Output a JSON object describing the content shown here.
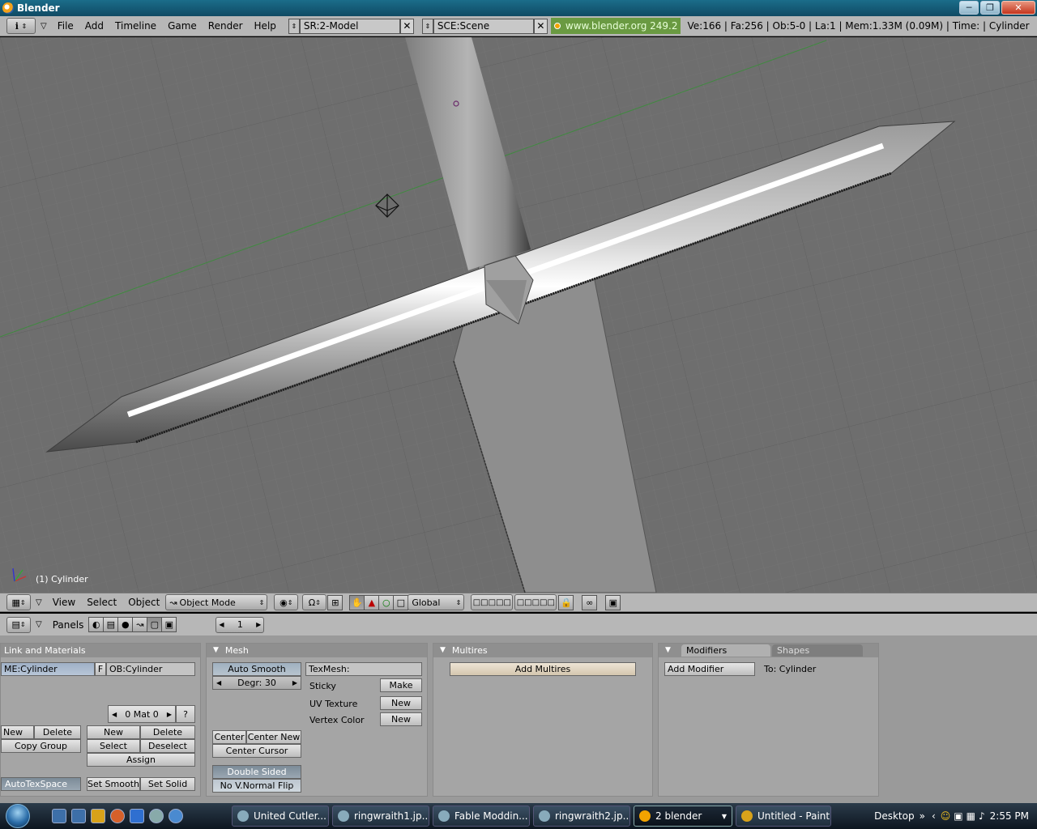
{
  "window": {
    "title": "Blender"
  },
  "infobar": {
    "menus": [
      "File",
      "Add",
      "Timeline",
      "Game",
      "Render",
      "Help"
    ],
    "screen": "SR:2-Model",
    "scene": "SCE:Scene",
    "url": "www.blender.org 249.2",
    "stats": "Ve:166 | Fa:256 | Ob:5-0 | La:1  | Mem:1.33M (0.09M)  | Time: | Cylinder"
  },
  "viewport": {
    "object_label": "(1) Cylinder"
  },
  "view_header": {
    "menus": [
      "View",
      "Select",
      "Object"
    ],
    "mode": "Object Mode",
    "orientation": "Global"
  },
  "buttons_header": {
    "panels_label": "Panels",
    "frame": "1"
  },
  "link_panel": {
    "title": "Link and Materials",
    "mesh_name": "ME:Cylinder",
    "f_label": "F",
    "object_name": "OB:Cylinder",
    "mat_field": "0 Mat 0",
    "question": "?",
    "new": "New",
    "delete": "Delete",
    "copy_group": "Copy Group",
    "mat_new": "New",
    "mat_delete": "Delete",
    "mat_select": "Select",
    "mat_deselect": "Deselect",
    "assign": "Assign",
    "autotexspace": "AutoTexSpace",
    "set_smooth": "Set Smooth",
    "set_solid": "Set Solid"
  },
  "mesh_panel": {
    "title": "Mesh",
    "auto_smooth": "Auto Smooth",
    "degr": "Degr: 30",
    "texmesh": "TexMesh:",
    "sticky": "Sticky",
    "sticky_btn": "Make",
    "uv_texture": "UV Texture",
    "uv_btn": "New",
    "vertex_color": "Vertex Color",
    "vc_btn": "New",
    "center": "Center",
    "center_new": "Center New",
    "center_cursor": "Center Cursor",
    "double_sided": "Double Sided",
    "no_vnormal_flip": "No V.Normal Flip"
  },
  "multires_panel": {
    "title": "Multires",
    "add_multires": "Add Multires"
  },
  "modifiers_panel": {
    "tab_modifiers": "Modifiers",
    "tab_shapes": "Shapes",
    "add_modifier": "Add Modifier",
    "to_label": "To: Cylinder"
  },
  "taskbar": {
    "tasks": [
      "United Cutler...",
      "ringwraith1.jp...",
      "Fable Moddin...",
      "ringwraith2.jp...",
      "2 blender",
      "Untitled - Paint"
    ],
    "desktop": "Desktop",
    "time": "2:55 PM"
  }
}
